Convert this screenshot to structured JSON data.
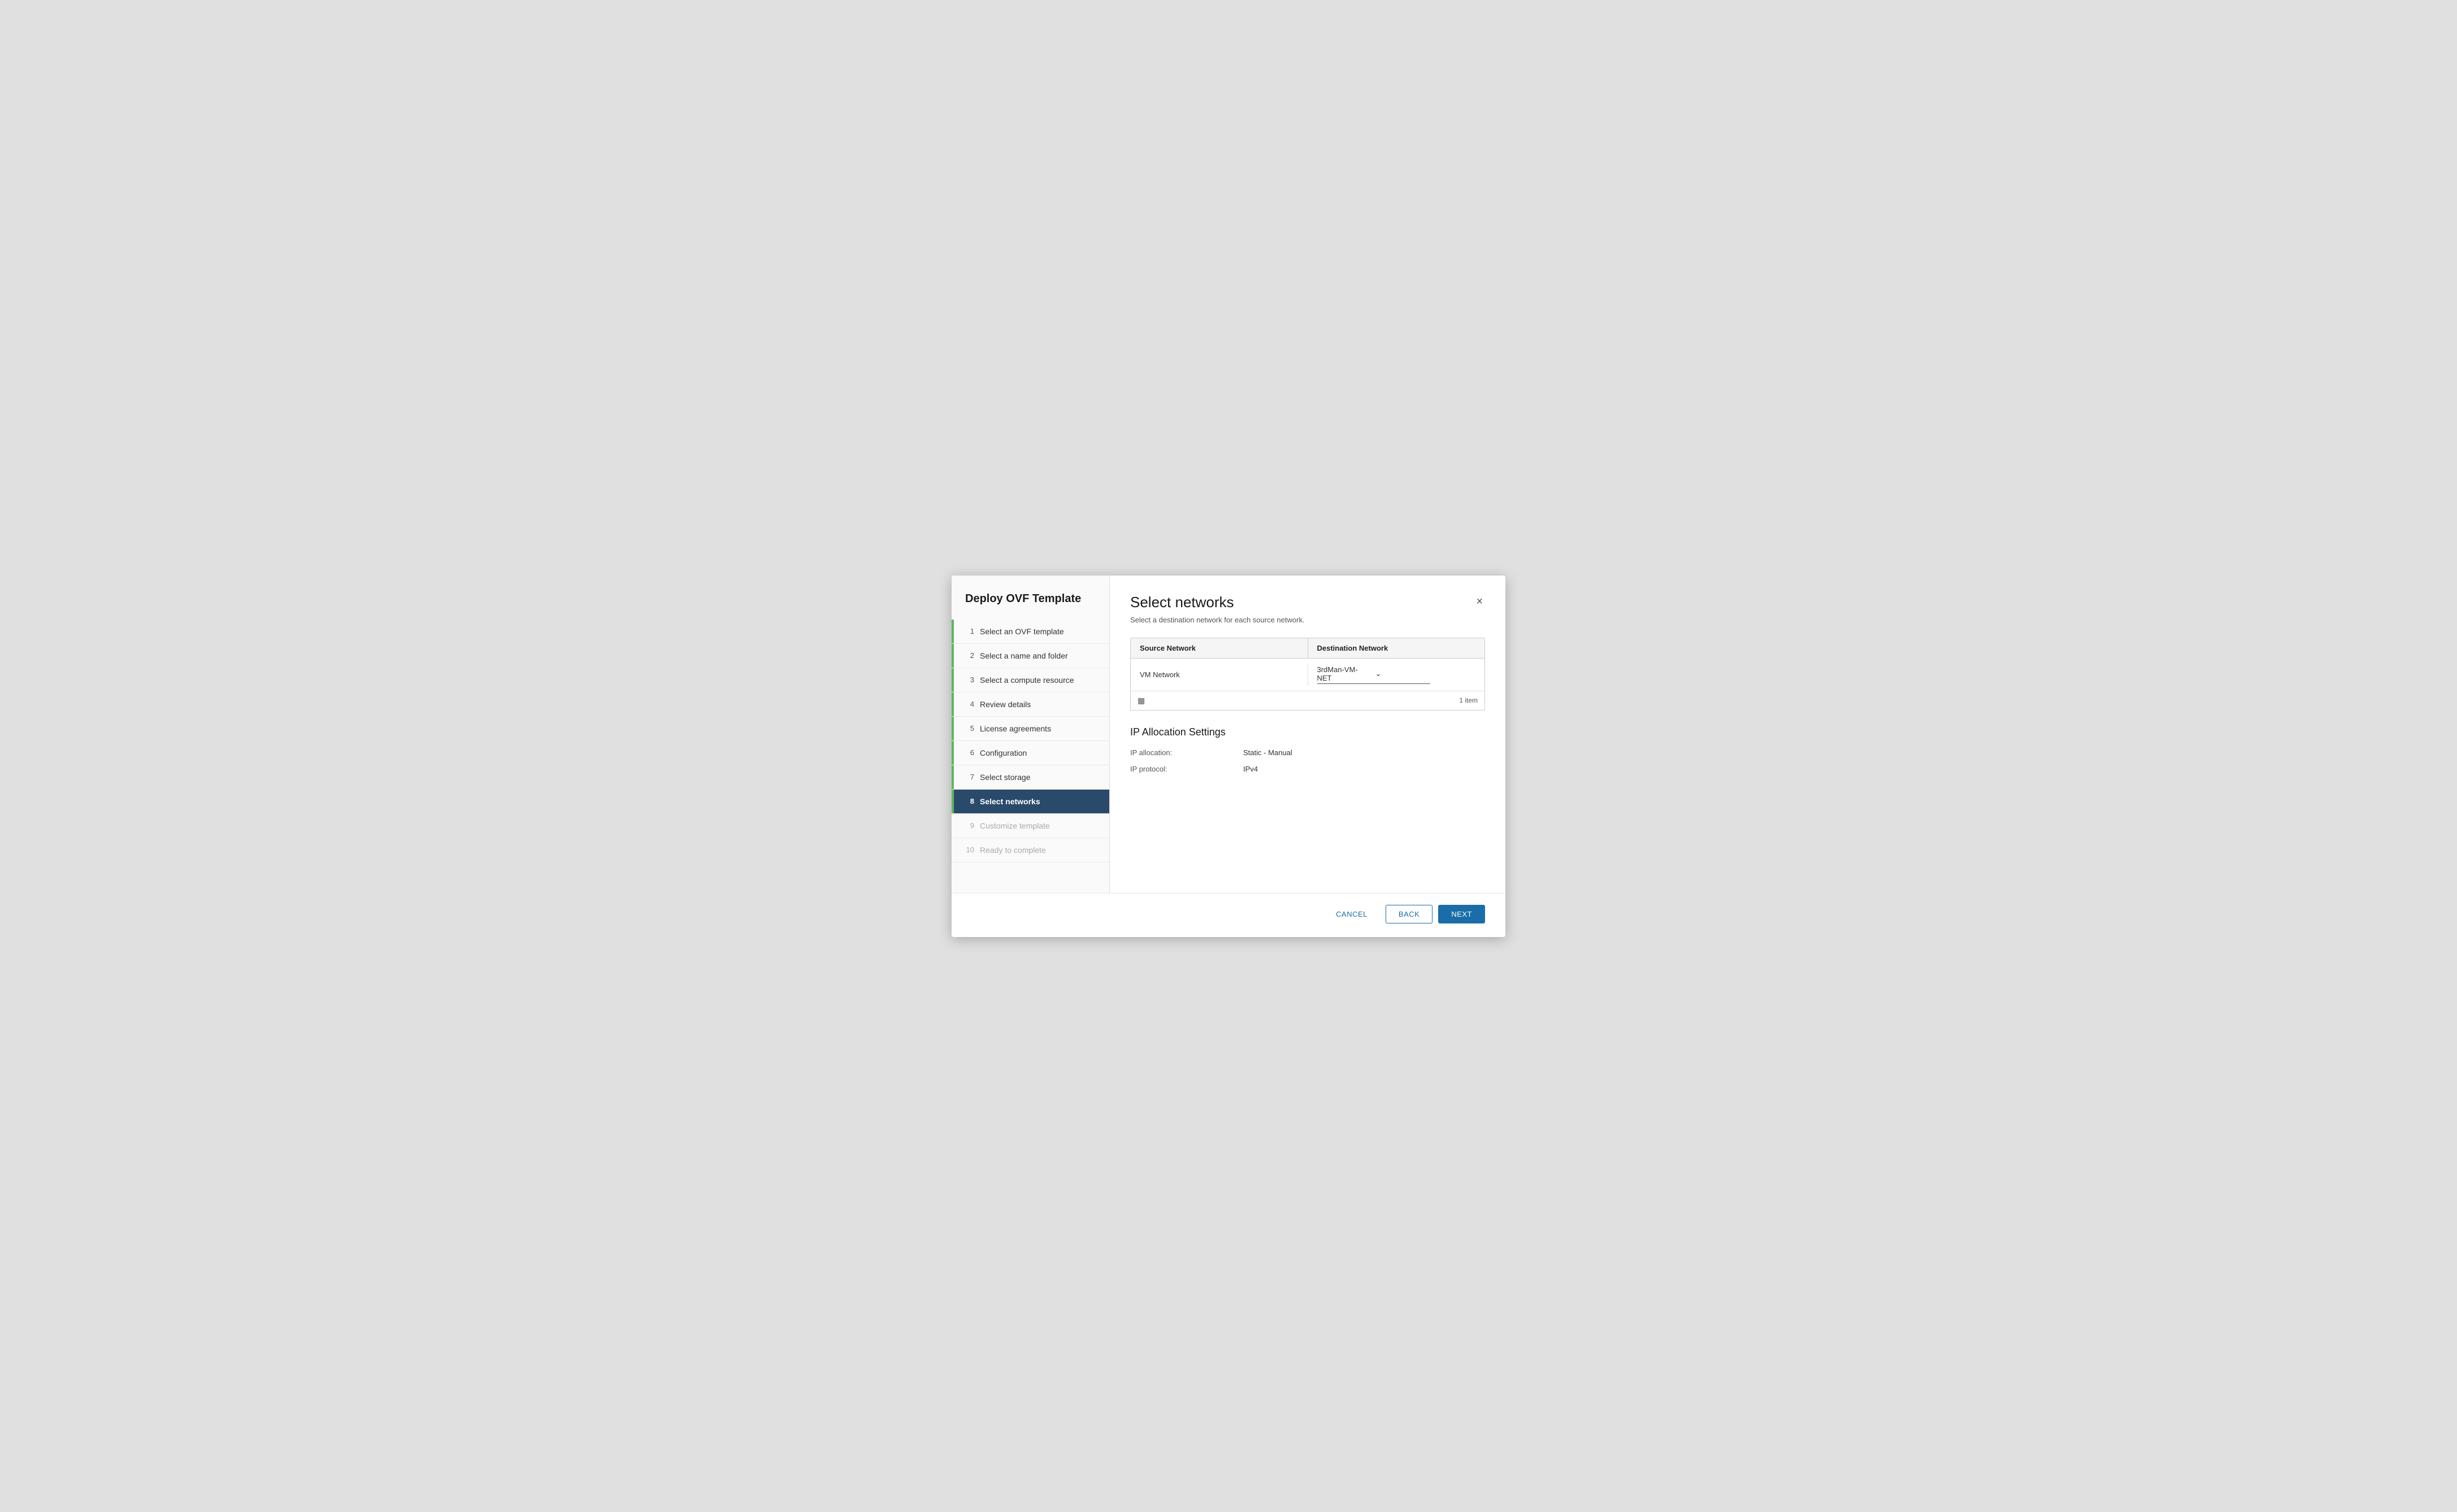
{
  "sidebar": {
    "title": "Deploy OVF Template",
    "steps": [
      {
        "number": "1",
        "label": "Select an OVF template",
        "state": "completed"
      },
      {
        "number": "2",
        "label": "Select a name and folder",
        "state": "completed"
      },
      {
        "number": "3",
        "label": "Select a compute resource",
        "state": "completed"
      },
      {
        "number": "4",
        "label": "Review details",
        "state": "completed"
      },
      {
        "number": "5",
        "label": "License agreements",
        "state": "completed"
      },
      {
        "number": "6",
        "label": "Configuration",
        "state": "completed"
      },
      {
        "number": "7",
        "label": "Select storage",
        "state": "completed"
      },
      {
        "number": "8",
        "label": "Select networks",
        "state": "active"
      },
      {
        "number": "9",
        "label": "Customize template",
        "state": "disabled"
      },
      {
        "number": "10",
        "label": "Ready to complete",
        "state": "disabled"
      }
    ]
  },
  "main": {
    "title": "Select networks",
    "subtitle": "Select a destination network for each source network.",
    "table": {
      "col1_header": "Source Network",
      "col2_header": "Destination Network",
      "rows": [
        {
          "source": "VM Network",
          "destination": "3rdMan-VM-NET"
        }
      ],
      "item_count": "1 item"
    },
    "ip_allocation": {
      "section_title": "IP Allocation Settings",
      "allocation_label": "IP allocation:",
      "allocation_value": "Static - Manual",
      "protocol_label": "IP protocol:",
      "protocol_value": "IPv4"
    }
  },
  "footer": {
    "cancel_label": "CANCEL",
    "back_label": "BACK",
    "next_label": "NEXT"
  },
  "icons": {
    "close": "×",
    "chevron_down": "∨",
    "columns": "⊞"
  }
}
